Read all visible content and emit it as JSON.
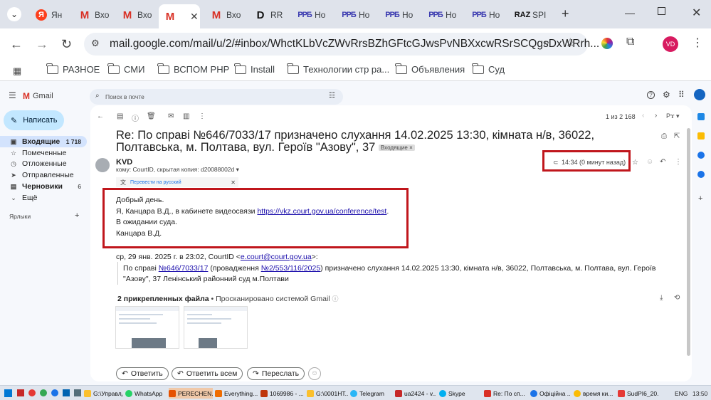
{
  "browser": {
    "tabs": [
      {
        "label": "Ян",
        "icon": "yandex-icon"
      },
      {
        "label": "Вхо",
        "icon": "gmail-icon"
      },
      {
        "label": "Вхо",
        "icon": "gmail-icon"
      },
      {
        "label": "",
        "icon": "gmail-icon",
        "active": true
      },
      {
        "label": "Вхо",
        "icon": "gmail-icon"
      },
      {
        "label": "RR",
        "icon": "d-icon"
      },
      {
        "label": "Но",
        "icon": "rr-icon"
      },
      {
        "label": "Но",
        "icon": "rr-icon"
      },
      {
        "label": "Но",
        "icon": "rr-icon"
      },
      {
        "label": "Но",
        "icon": "rr-icon"
      },
      {
        "label": "Но",
        "icon": "rr-icon"
      },
      {
        "label": "SPI",
        "icon": "raz-icon"
      }
    ],
    "url": "mail.google.com/mail/u/2/#inbox/WhctKLbVcZWvRrsBZhGFtcGJwsPvNBXxcwRSrSCQgsDxWRrh...",
    "profile_initials": "VD",
    "bookmarks": [
      "РАЗНОЕ",
      "СМИ",
      "ВСПОМ РНР",
      "Install",
      "Технологии стр ра...",
      "Объявления",
      "Суд"
    ]
  },
  "gmail": {
    "logo": "Gmail",
    "search_placeholder": "Поиск в почте",
    "compose": "Написать",
    "nav": [
      {
        "label": "Входящие",
        "count": "1 718",
        "selected": true
      },
      {
        "label": "Помеченные",
        "count": ""
      },
      {
        "label": "Отложенные",
        "count": ""
      },
      {
        "label": "Отправленные",
        "count": ""
      },
      {
        "label": "Черновики",
        "count": "6",
        "bold": true
      },
      {
        "label": "Ещё",
        "count": ""
      }
    ],
    "labels_heading": "Ярлыки",
    "pagination": "1 из 2 168",
    "subject": "Re: По справі №646/7033/17 призначено слухання 14.02.2025 13:30, кімната н/в, 36022, Полтавська, м. Полтава, вул. Героїв \"Азову\", 37",
    "inbox_chip": "Входящие ×",
    "sender": "KVD",
    "recipients": "кому: CourtID, скрытая копия: d20088002d",
    "time": "14:34 (0 минут назад)",
    "translate": "Перевести на русский",
    "body": [
      "Добрый день.",
      "Я, Канцара В.Д., в кабинете видеосвязи ",
      "В ожидании суда.",
      "Канцара В.Д."
    ],
    "body_link": "https://vkz.court.gov.ua/conference/test",
    "body_link_suffix": ".",
    "quote_header_prefix": "ср, 29 янв. 2025 г. в 23:02, CourtID <",
    "quote_header_email": "e.court@court.gov.ua",
    "quote_header_suffix": ">:",
    "quote_line1_a": "По справі ",
    "quote_link1": "№646/7033/17",
    "quote_line1_b": " (провадження ",
    "quote_link2": "№2/553/116/2025",
    "quote_line1_c": ") призначено слухання 14.02.2025 13:30, кімната н/в, 36022, Полтавська, м. Полтава, вул. Героїв",
    "quote_line2": "\"Азову\", 37 Ленінський районний суд м.Полтави",
    "attachments_title": "2 прикрепленных файла",
    "attachments_scan": "• Просканировано системой Gmail",
    "reply": "Ответить",
    "reply_all": "Ответить всем",
    "forward": "Переслать"
  },
  "taskbar": {
    "items": [
      {
        "label": "G:\\Управлд..."
      },
      {
        "label": "WhatsApp"
      },
      {
        "label": "PERECHEN..."
      },
      {
        "label": "Everything..."
      },
      {
        "label": "1069986 - ..."
      },
      {
        "label": "G:\\0001НТ..."
      },
      {
        "label": "Telegram"
      },
      {
        "label": "ua2424 - v..."
      },
      {
        "label": "Skype"
      },
      {
        "label": "Re: По сп..."
      },
      {
        "label": "Офіційна ..."
      },
      {
        "label": "время ки..."
      },
      {
        "label": "SudPI6_20..."
      }
    ],
    "lang": "ENG",
    "clock": "13:50"
  },
  "colors": {
    "highlight_box": "#c0161c",
    "compose_bg": "#c2e7ff",
    "selected_nav": "#d3e3fd"
  }
}
